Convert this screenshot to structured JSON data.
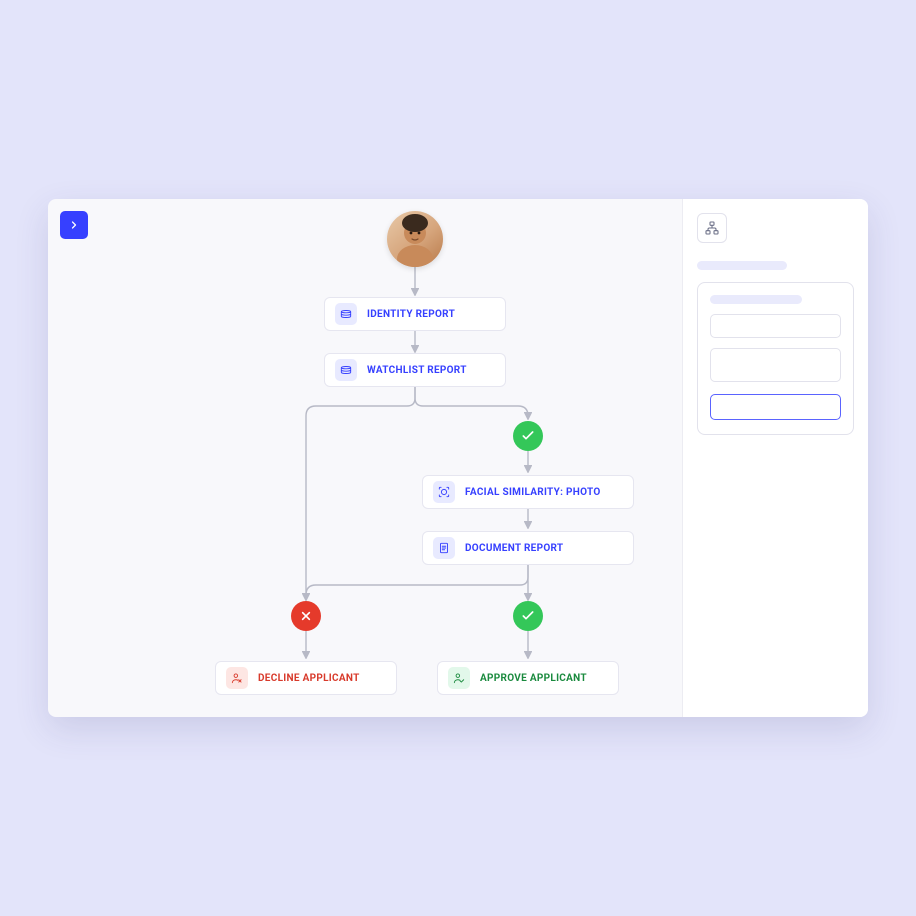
{
  "flow": {
    "steps": {
      "identity": {
        "label": "IDENTITY REPORT",
        "icon": "report-icon"
      },
      "watchlist": {
        "label": "WATCHLIST REPORT",
        "icon": "report-icon"
      },
      "facial": {
        "label": "FACIAL SIMILARITY: PHOTO",
        "icon": "face-scan-icon"
      },
      "document": {
        "label": "DOCUMENT REPORT",
        "icon": "document-icon"
      },
      "decline": {
        "label": "DECLINE APPLICANT",
        "icon": "user-x-icon"
      },
      "approve": {
        "label": "APPROVE APPLICANT",
        "icon": "user-check-icon"
      }
    },
    "decisions": {
      "pass1": "pass",
      "pass2": "pass",
      "fail": "fail"
    }
  },
  "colors": {
    "accent": "#3640ff",
    "pass": "#34c759",
    "fail": "#e53a2b"
  }
}
